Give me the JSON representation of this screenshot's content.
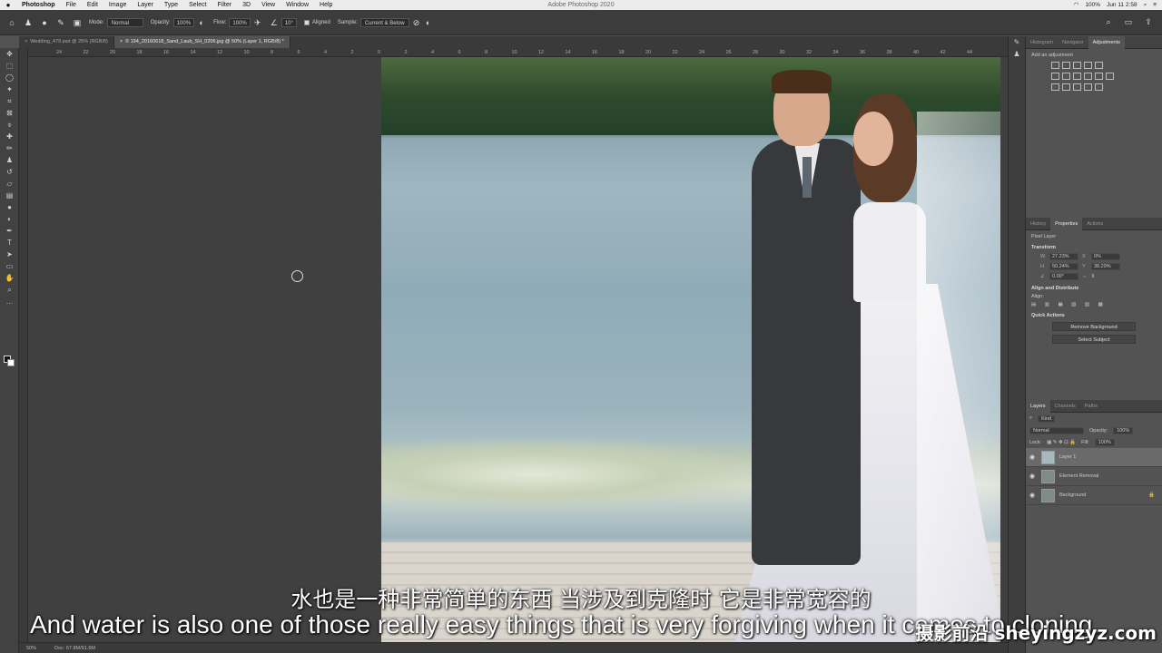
{
  "menubar": {
    "apple": "",
    "items": [
      "Photoshop",
      "File",
      "Edit",
      "Image",
      "Layer",
      "Type",
      "Select",
      "Filter",
      "3D",
      "View",
      "Window",
      "Help"
    ],
    "app_title": "Adobe Photoshop 2020",
    "status": {
      "battery": "100%",
      "datetime": "Jun 11  2:58"
    }
  },
  "options_bar": {
    "mode_label": "Mode:",
    "mode_value": "Normal",
    "opacity_label": "Opacity:",
    "opacity_value": "100%",
    "flow_label": "Flow:",
    "flow_value": "100%",
    "angle_value": "10°",
    "aligned_label": "Aligned",
    "sample_label": "Sample:",
    "sample_value": "Current & Below"
  },
  "document_tabs": [
    {
      "close": "×",
      "label": "Wedding_479.psd @ 25% (RGB/8)"
    },
    {
      "close": "×",
      "label": "© 194_20160618_Sand_Laub_SH_0206.jpg @ 50% (Layer 1, RGB/8) *"
    }
  ],
  "ruler_ticks": [
    "24",
    "22",
    "20",
    "18",
    "16",
    "14",
    "12",
    "10",
    "8",
    "6",
    "4",
    "2",
    "0",
    "2",
    "4",
    "6",
    "8",
    "10",
    "12",
    "14",
    "16",
    "18",
    "20",
    "22",
    "24",
    "26",
    "28",
    "30",
    "32",
    "34",
    "36",
    "38",
    "40",
    "42",
    "44"
  ],
  "status_bar": {
    "zoom": "50%",
    "doc": "Doc: 67.8M/91.6M"
  },
  "subtitles": {
    "chinese": "水也是一种非常简单的东西 当涉及到克隆时 它是非常宽容的",
    "english": "And water is also one of those really easy things that is very forgiving when it comes to cloning.",
    "watermark": "摄影前沿 sheyingzyz.com"
  },
  "panels": {
    "top_tabs": [
      "Histogram",
      "Navigator",
      "Adjustments"
    ],
    "adjustments_hint": "Add an adjustment",
    "mid_tabs": [
      "History",
      "Properties",
      "Actions"
    ],
    "properties": {
      "layer_type": "Pixel Layer",
      "transform_title": "Transform",
      "w_label": "W",
      "w_value": "27.23%",
      "x_label": "X",
      "x_value": "0%",
      "h_label": "H",
      "h_value": "50.24%",
      "y_label": "Y",
      "y_value": "38.29%",
      "angle_value": "0.00°",
      "align_title": "Align and Distribute",
      "align_label": "Align:",
      "quick_actions_title": "Quick Actions",
      "remove_bg": "Remove Background",
      "select_subject": "Select Subject"
    },
    "layers_tabs": [
      "Layers",
      "Channels",
      "Paths"
    ],
    "layers_filter": "Kind",
    "blend_mode": "Normal",
    "opacity_label": "Opacity:",
    "opacity_value": "100%",
    "lock_label": "Lock:",
    "fill_label": "Fill:",
    "fill_value": "100%",
    "layers": [
      {
        "name": "Layer 1",
        "selected": true
      },
      {
        "name": "Element Removal",
        "selected": false
      },
      {
        "name": "Background",
        "selected": false
      }
    ]
  },
  "colors": {
    "accent_tab": "#535353",
    "panel_bg": "#535353",
    "toolbar_bg": "#424242"
  }
}
